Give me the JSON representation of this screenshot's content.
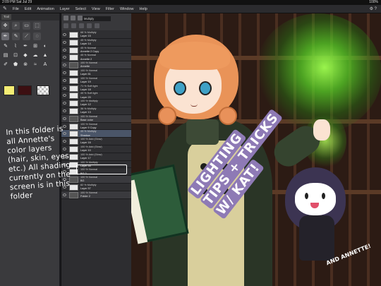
{
  "status_bar": {
    "time": "2:09 PM   Sat Jul 29",
    "battery": "100%"
  },
  "menu": {
    "logo_icon": "clip-studio-logo-icon",
    "items": [
      "File",
      "Edit",
      "Animation",
      "Layer",
      "Select",
      "View",
      "Filter",
      "Window",
      "Help"
    ],
    "right_icons": "⚙ ?"
  },
  "tool_panel": {
    "tab_label": "Tool",
    "tool_icons": [
      "✥",
      "⌕",
      "▭",
      "⬚",
      "✒",
      "✎",
      "⟋",
      "◌"
    ],
    "sub_tool_icons": [
      "✎",
      "⌇",
      "✒",
      "⊞",
      "◐",
      "▤",
      "⊡",
      "◆",
      "☁",
      "▲",
      "✐",
      "⬟",
      "⊗",
      "≈",
      "A"
    ],
    "main_color": "#f4ed74",
    "sub_color": "#3c0f12"
  },
  "layers": {
    "blend_mode": "Multiply",
    "items": [
      {
        "mode": "68 %  Multiply",
        "name": "Layer 15",
        "folder": false
      },
      {
        "mode": "45 %  Multiply",
        "name": "Layer 14",
        "folder": false
      },
      {
        "mode": "45 %  Normal",
        "name": "Annette 2 Copy",
        "folder": false
      },
      {
        "mode": "45 %  Normal",
        "name": "Annette 2",
        "folder": false
      },
      {
        "mode": "100 %  Normal",
        "name": "Annette",
        "folder": true
      },
      {
        "mode": "100 %  Normal",
        "name": "Layer 81",
        "folder": false
      },
      {
        "mode": "100 %  Normal",
        "name": "Layer 19",
        "folder": false
      },
      {
        "mode": "71 %  Soft light",
        "name": "Layer 18",
        "folder": false
      },
      {
        "mode": "45 %  Soft light",
        "name": "Layer 20",
        "folder": false
      },
      {
        "mode": "100 %  Multiply",
        "name": "Layer 12",
        "folder": false
      },
      {
        "mode": "36 %  Multiply",
        "name": "Layer 13",
        "folder": false
      },
      {
        "mode": "100 %  Normal",
        "name": "Base color",
        "folder": true
      },
      {
        "mode": "100 %  Normal",
        "name": "Layer 9 Copy",
        "folder": false
      },
      {
        "mode": "45 %  Multiply",
        "name": "Shadow",
        "folder": false
      },
      {
        "mode": "100 %  Add (Glow)",
        "name": "Layer 16",
        "folder": false
      },
      {
        "mode": "100 %  Add (Glow)",
        "name": "Layer 10",
        "folder": false
      },
      {
        "mode": "100 %  Add (Glow)",
        "name": "Layer 17",
        "folder": false
      },
      {
        "mode": "100 %  Multiply",
        "name": "Layer 55",
        "folder": false
      },
      {
        "mode": "100 %  Normal",
        "name": "BG 2",
        "folder": false
      },
      {
        "mode": "100 %  Normal",
        "name": "BG",
        "folder": true
      },
      {
        "mode": "82 %  Multiply",
        "name": "Layer 57",
        "folder": false
      },
      {
        "mode": "100 %  Normal",
        "name": "Folder 2",
        "folder": true
      }
    ]
  },
  "annotation": {
    "text": "In this folder is all Annette's color layers (hair, skin, eyes, etc.) All shading currently on the screen is in this folder"
  },
  "artwork": {
    "title_lines": [
      "LIGHTING",
      "TIPS + TRICKS",
      "W/ KAT!"
    ],
    "signature": "AND ANNETTE!"
  }
}
